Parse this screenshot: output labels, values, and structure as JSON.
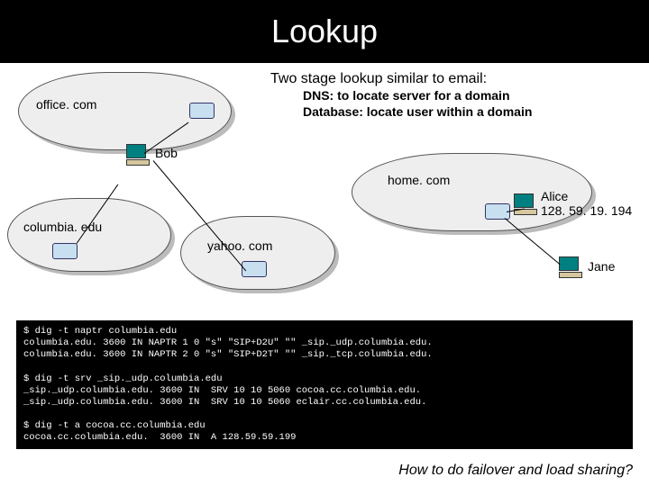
{
  "title": "Lookup",
  "subtitle": {
    "main": "Two stage lookup similar to email:",
    "line1": "DNS: to locate server for a domain",
    "line2": "Database: locate user within a domain"
  },
  "clouds": {
    "office": "office. com",
    "columbia": "columbia. edu",
    "yahoo": "yahoo. com",
    "home": "home. com"
  },
  "people": {
    "bob": "Bob",
    "alice_name": "Alice",
    "alice_ip": "128. 59. 19. 194",
    "jane": "Jane"
  },
  "terminal": {
    "block1_l1": "$ dig -t naptr columbia.edu",
    "block1_l2": "columbia.edu. 3600 IN NAPTR 1 0 \"s\" \"SIP+D2U\" \"\" _sip._udp.columbia.edu.",
    "block1_l3": "columbia.edu. 3600 IN NAPTR 2 0 \"s\" \"SIP+D2T\" \"\" _sip._tcp.columbia.edu.",
    "block2_l1": "$ dig -t srv _sip._udp.columbia.edu",
    "block2_l2": "_sip._udp.columbia.edu. 3600 IN  SRV 10 10 5060 cocoa.cc.columbia.edu.",
    "block2_l3": "_sip._udp.columbia.edu. 3600 IN  SRV 10 10 5060 eclair.cc.columbia.edu.",
    "block3_l1": "$ dig -t a cocoa.cc.columbia.edu",
    "block3_l2": "cocoa.cc.columbia.edu.  3600 IN  A 128.59.59.199"
  },
  "footer": "How to do failover and load sharing?"
}
